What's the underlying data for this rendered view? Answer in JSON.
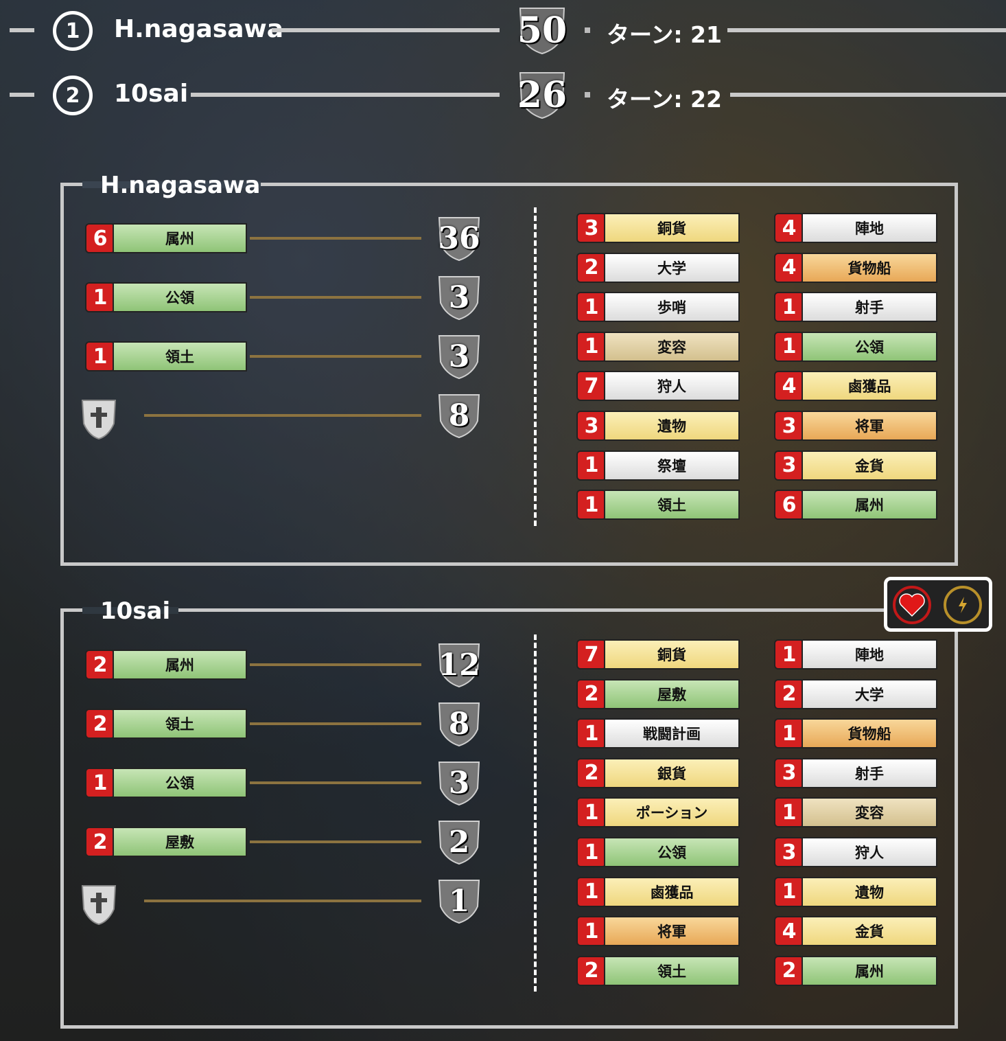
{
  "header": [
    {
      "rank": "1",
      "name": "H.nagasawa",
      "score": "50",
      "turn": "ターン: 21"
    },
    {
      "rank": "2",
      "name": "10sai",
      "score": "26",
      "turn": "ターン: 22"
    }
  ],
  "players": [
    {
      "name": "H.nagasawa",
      "categories": [
        {
          "count": "6",
          "label": "属州",
          "score": "36"
        },
        {
          "count": "1",
          "label": "公領",
          "score": "3"
        },
        {
          "count": "1",
          "label": "領土",
          "score": "3"
        }
      ],
      "bonus_score": "8",
      "cards_left": [
        {
          "count": "3",
          "label": "銅貨",
          "color": "yellow"
        },
        {
          "count": "2",
          "label": "大学",
          "color": "white"
        },
        {
          "count": "1",
          "label": "歩哨",
          "color": "white"
        },
        {
          "count": "1",
          "label": "変容",
          "color": "tan"
        },
        {
          "count": "7",
          "label": "狩人",
          "color": "white"
        },
        {
          "count": "3",
          "label": "遺物",
          "color": "yellow"
        },
        {
          "count": "1",
          "label": "祭壇",
          "color": "white"
        },
        {
          "count": "1",
          "label": "領土",
          "color": "green"
        }
      ],
      "cards_right": [
        {
          "count": "4",
          "label": "陣地",
          "color": "white"
        },
        {
          "count": "4",
          "label": "貨物船",
          "color": "orange"
        },
        {
          "count": "1",
          "label": "射手",
          "color": "white"
        },
        {
          "count": "1",
          "label": "公領",
          "color": "green"
        },
        {
          "count": "4",
          "label": "鹵獲品",
          "color": "yellow"
        },
        {
          "count": "3",
          "label": "将軍",
          "color": "orange"
        },
        {
          "count": "3",
          "label": "金貨",
          "color": "yellow"
        },
        {
          "count": "6",
          "label": "属州",
          "color": "green"
        }
      ]
    },
    {
      "name": "10sai",
      "categories": [
        {
          "count": "2",
          "label": "属州",
          "score": "12"
        },
        {
          "count": "2",
          "label": "領土",
          "score": "8"
        },
        {
          "count": "1",
          "label": "公領",
          "score": "3"
        },
        {
          "count": "2",
          "label": "屋敷",
          "score": "2"
        }
      ],
      "bonus_score": "1",
      "cards_left": [
        {
          "count": "7",
          "label": "銅貨",
          "color": "yellow"
        },
        {
          "count": "2",
          "label": "屋敷",
          "color": "green"
        },
        {
          "count": "1",
          "label": "戦闘計画",
          "color": "white"
        },
        {
          "count": "2",
          "label": "銀貨",
          "color": "yellow"
        },
        {
          "count": "1",
          "label": "ポーション",
          "color": "yellow"
        },
        {
          "count": "1",
          "label": "公領",
          "color": "green"
        },
        {
          "count": "1",
          "label": "鹵獲品",
          "color": "yellow"
        },
        {
          "count": "1",
          "label": "将軍",
          "color": "orange"
        },
        {
          "count": "2",
          "label": "領土",
          "color": "green"
        }
      ],
      "cards_right": [
        {
          "count": "1",
          "label": "陣地",
          "color": "white"
        },
        {
          "count": "2",
          "label": "大学",
          "color": "white"
        },
        {
          "count": "1",
          "label": "貨物船",
          "color": "orange"
        },
        {
          "count": "3",
          "label": "射手",
          "color": "white"
        },
        {
          "count": "1",
          "label": "変容",
          "color": "tan"
        },
        {
          "count": "3",
          "label": "狩人",
          "color": "white"
        },
        {
          "count": "1",
          "label": "遺物",
          "color": "yellow"
        },
        {
          "count": "4",
          "label": "金貨",
          "color": "yellow"
        },
        {
          "count": "2",
          "label": "属州",
          "color": "green"
        }
      ]
    }
  ],
  "status_icons": [
    "heart-icon",
    "lightning-icon"
  ],
  "colors": {
    "count_badge": "#d42020",
    "line": "#c9c9c9",
    "gold_line": "#8c7340"
  }
}
